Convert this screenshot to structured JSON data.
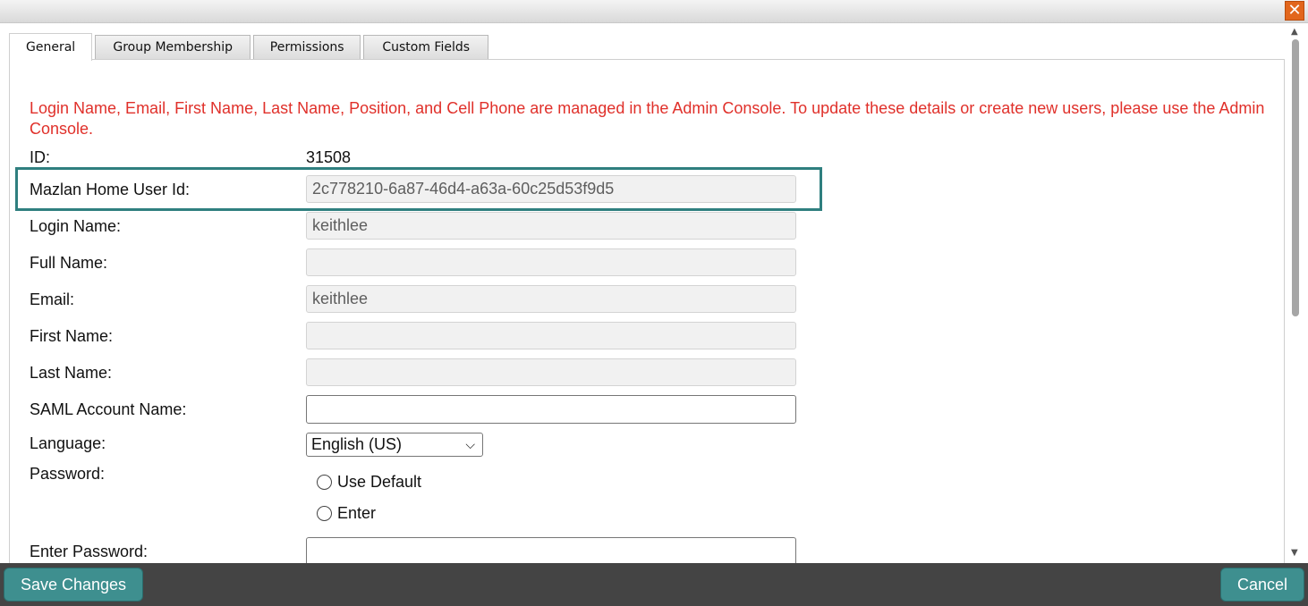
{
  "window": {
    "close_label": "✕"
  },
  "tabs": [
    {
      "label": "General"
    },
    {
      "label": "Group Membership"
    },
    {
      "label": "Permissions"
    },
    {
      "label": "Custom Fields"
    }
  ],
  "notice": "Login Name, Email, First Name, Last Name, Position, and Cell Phone are managed in the Admin Console. To update these details or create new users, please use the Admin Console.",
  "fields": {
    "id": {
      "label": "ID:",
      "value": "31508"
    },
    "home_user_id": {
      "label": "Mazlan Home User Id:",
      "value": "2c778210-6a87-46d4-a63a-60c25d53f9d5"
    },
    "login_name": {
      "label": "Login Name:",
      "value": "keithlee"
    },
    "full_name": {
      "label": "Full Name:",
      "value": ""
    },
    "email": {
      "label": "Email:",
      "value": "keithlee"
    },
    "first_name": {
      "label": "First Name:",
      "value": ""
    },
    "last_name": {
      "label": "Last Name:",
      "value": ""
    },
    "saml": {
      "label": "SAML Account Name:",
      "value": ""
    },
    "language": {
      "label": "Language:",
      "value": "English (US)"
    },
    "password": {
      "label": "Password:",
      "options": [
        "Use Default",
        "Enter"
      ]
    },
    "enter_password": {
      "label": "Enter Password:",
      "value": ""
    }
  },
  "footer": {
    "save_label": "Save Changes",
    "cancel_label": "Cancel"
  },
  "colors": {
    "accent": "#3e8f8f",
    "notice": "#e0302a",
    "highlight": "#2f7f7f",
    "close": "#e2661c"
  }
}
